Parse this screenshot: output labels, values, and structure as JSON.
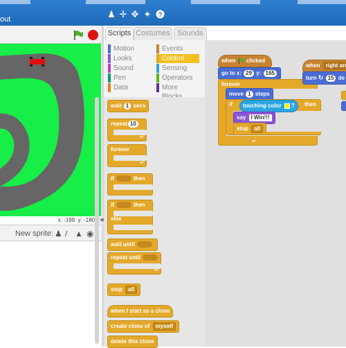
{
  "window": {
    "title_fragment": "out"
  },
  "toolbar": {
    "icons": [
      "duplicate-icon",
      "cut-icon",
      "grow-icon",
      "shrink-icon",
      "help-icon"
    ]
  },
  "stage": {
    "coords_x_label": "x:",
    "coords_x": "-199",
    "coords_y_label": "y:",
    "coords_y": "-180",
    "colors": {
      "background": "#17ee47",
      "track": "#666666",
      "car": "#e01010"
    }
  },
  "new_sprite": {
    "label": "New sprite:"
  },
  "tabs": [
    "Scripts",
    "Costumes",
    "Sounds"
  ],
  "categories": {
    "left": [
      {
        "label": "Motion",
        "color": "#4a6cd4"
      },
      {
        "label": "Looks",
        "color": "#8a55d7"
      },
      {
        "label": "Sound",
        "color": "#bb42c3"
      },
      {
        "label": "Pen",
        "color": "#0e9a6c"
      },
      {
        "label": "Data",
        "color": "#ee7d16"
      }
    ],
    "right": [
      {
        "label": "Events",
        "color": "#c88330"
      },
      {
        "label": "Control",
        "color": "#e1a91a"
      },
      {
        "label": "Sensing",
        "color": "#2ca5e2"
      },
      {
        "label": "Operators",
        "color": "#5cb712"
      },
      {
        "label": "More Blocks",
        "color": "#632d99"
      }
    ]
  },
  "palette_blocks": {
    "wait_secs": {
      "pre": "wait",
      "value": "1",
      "post": "secs"
    },
    "repeat": {
      "pre": "repeat",
      "value": "10"
    },
    "forever": "forever",
    "if_then": {
      "pre": "if",
      "post": "then"
    },
    "if_then_else": {
      "pre": "if",
      "post": "then",
      "else": "else"
    },
    "wait_until": "wait until",
    "repeat_until": "repeat until",
    "stop": {
      "pre": "stop",
      "option": "all"
    },
    "clone_hat": "when I start as a clone",
    "create_clone": {
      "pre": "create clone of",
      "option": "myself"
    },
    "delete_clone": "delete this clone"
  },
  "script1": {
    "hat_pre": "when",
    "hat_post": "clicked",
    "goto_pre": "go to x:",
    "goto_x": "29",
    "goto_mid": "y:",
    "goto_y": "165",
    "forever": "forever",
    "move_pre": "move",
    "move_value": "1",
    "move_post": "steps",
    "if": "if",
    "touching": "touching color",
    "touching_post": "?",
    "then": "then",
    "say_pre": "say",
    "say_value": "I Win!!!",
    "stop_pre": "stop",
    "stop_option": "all"
  },
  "script2": {
    "hat_pre": "when",
    "hat_key": "right arrow",
    "turn_pre": "turn",
    "turn_value": "15",
    "turn_post": "de"
  }
}
